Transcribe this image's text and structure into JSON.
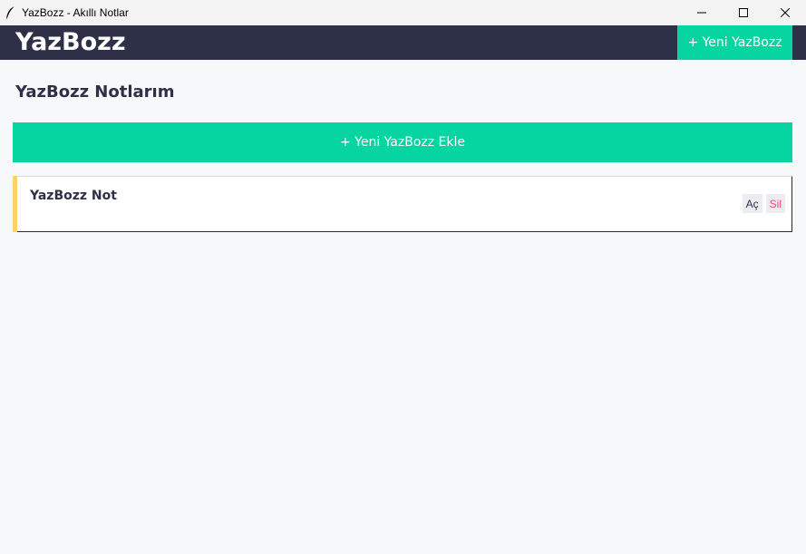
{
  "window": {
    "title": "YazBozz - Akıllı Notlar",
    "icon": "feather-icon"
  },
  "header": {
    "brand": "YazBozz",
    "new_button": "+ Yeni YazBozz"
  },
  "main": {
    "title": "YazBozz Notlarım",
    "add_button": "+ Yeni YazBozz Ekle"
  },
  "notes": [
    {
      "title": "YazBozz Not",
      "open_label": "Aç",
      "delete_label": "Sil"
    }
  ],
  "colors": {
    "header_bg": "#2d3047",
    "accent": "#07d5a1",
    "note_accent": "#ffd166",
    "delete_text": "#ef476f",
    "page_bg": "#f7f8fa"
  }
}
